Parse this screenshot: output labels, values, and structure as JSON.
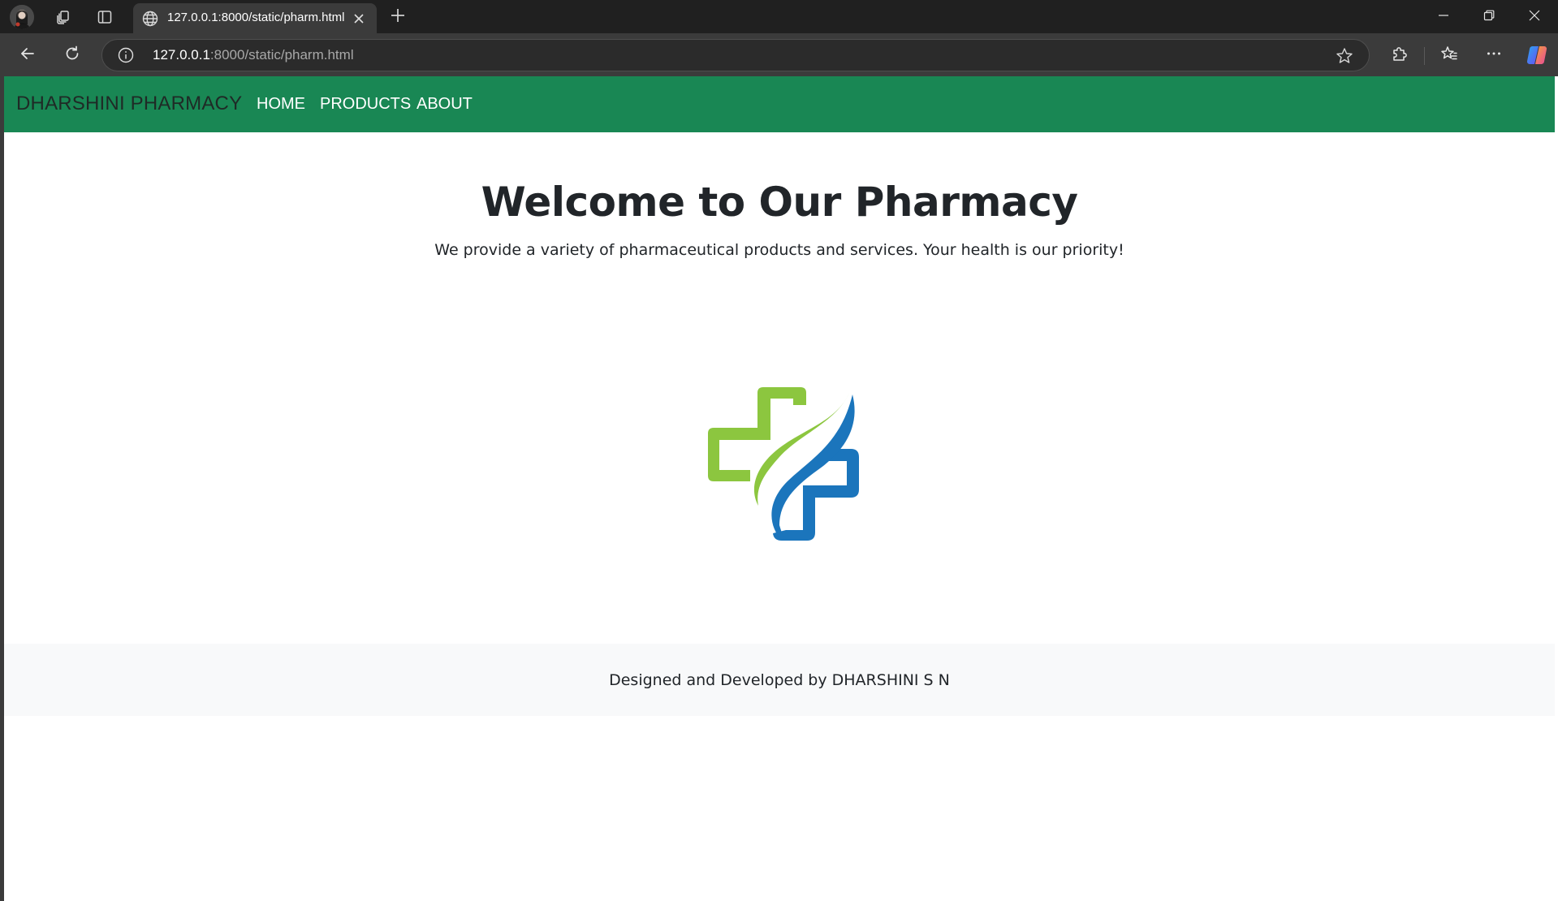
{
  "browser": {
    "tab": {
      "title": "127.0.0.1:8000/static/pharm.html"
    },
    "address": {
      "host": "127.0.0.1",
      "rest": ":8000/static/pharm.html"
    },
    "icons": {
      "profile": "avatar",
      "workspaces": "workspaces-icon",
      "tab_actions": "tab-actions-icon",
      "favicon": "globe-icon",
      "close": "close-icon",
      "new_tab": "plus-icon",
      "minimize": "minimize-icon",
      "restore": "restore-icon",
      "close_window": "close-icon",
      "back": "back-arrow-icon",
      "refresh": "refresh-icon",
      "site_info": "info-icon",
      "favorite": "star-icon",
      "extensions": "puzzle-icon",
      "favorites": "favorites-icon",
      "menu": "more-icon",
      "copilot": "copilot-icon"
    }
  },
  "page": {
    "navbar": {
      "brand": "DHARSHINI PHARMACY",
      "links": [
        "HOME",
        "PRODUCTS",
        "ABOUT"
      ],
      "background": "#198754"
    },
    "hero": {
      "title": "Welcome to Our Pharmacy",
      "subtitle": "We provide a variety of pharmaceutical products and services. Your health is our priority!"
    },
    "logo": {
      "icon": "medical-cross-logo",
      "colors": {
        "green": "#8cc63f",
        "blue": "#1b75bc"
      }
    },
    "footer": {
      "text": "Designed and Developed by DHARSHINI S N",
      "background": "#f8f9fa"
    }
  }
}
